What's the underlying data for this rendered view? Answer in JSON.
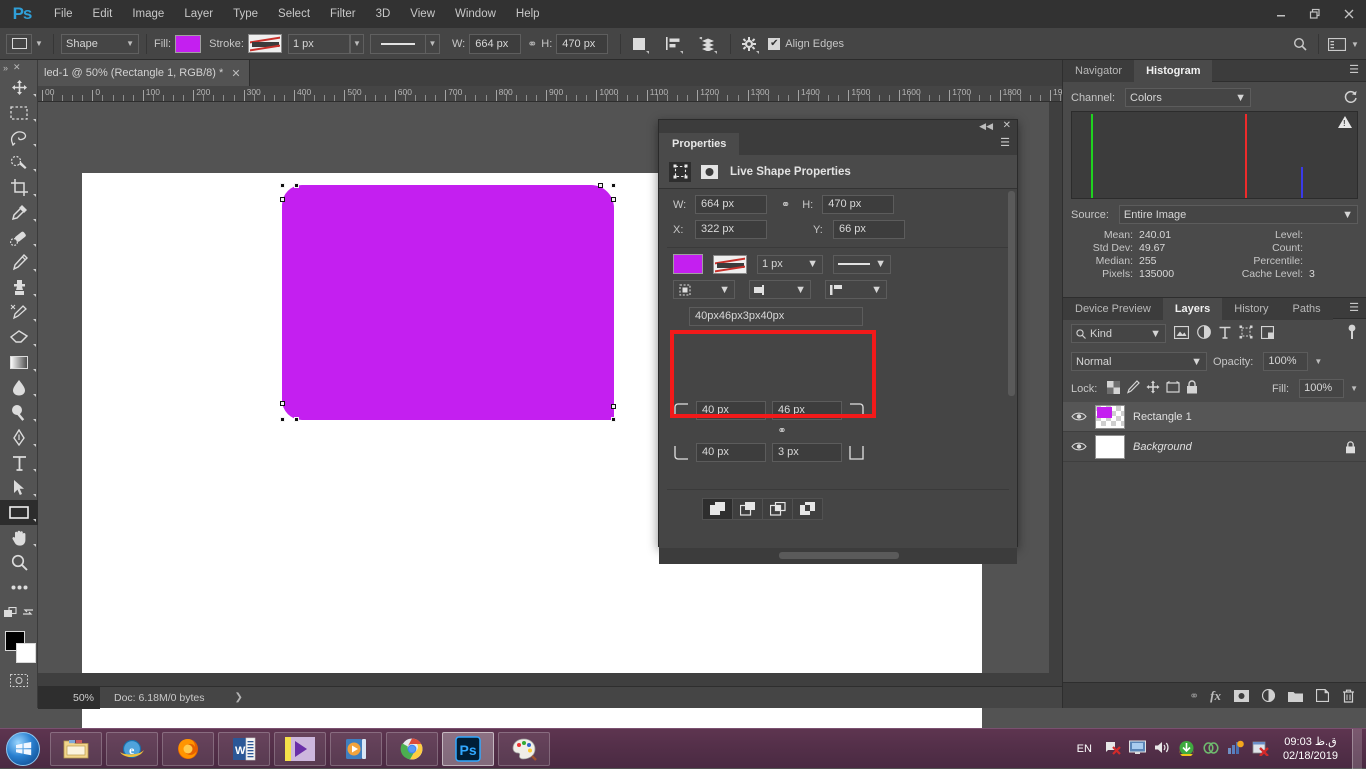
{
  "app": {
    "name": "Ps",
    "logo": "Ps"
  },
  "menubar": {
    "items": [
      "File",
      "Edit",
      "Image",
      "Layer",
      "Type",
      "Select",
      "Filter",
      "3D",
      "View",
      "Window",
      "Help"
    ],
    "window_buttons": [
      "minimize",
      "restore",
      "close"
    ]
  },
  "options_bar": {
    "tool_preset_icon": "rectangle-shape-icon",
    "mode": "Shape",
    "fill_label": "Fill:",
    "fill_color": "#c41ff0",
    "stroke_label": "Stroke:",
    "stroke_width": "1 px",
    "stroke_style": "solid-line",
    "w_label": "W:",
    "w_value": "664 px",
    "link_icon": "link-icon",
    "h_label": "H:",
    "h_value": "470 px",
    "path_op_icon": "path-operations-icon",
    "align_icon": "path-alignment-icon",
    "arrange_icon": "path-arrangement-icon",
    "gear_icon": "gear-icon",
    "align_edges_checked": true,
    "align_edges_label": "Align Edges",
    "search_icon": "search-icon",
    "workspace_icon": "workspace-icon"
  },
  "toolbar": {
    "tools": [
      {
        "name": "move-tool",
        "glyph": "move"
      },
      {
        "name": "rectangular-marquee-tool",
        "glyph": "marquee"
      },
      {
        "name": "lasso-tool",
        "glyph": "lasso"
      },
      {
        "name": "quick-selection-tool",
        "glyph": "quickselect"
      },
      {
        "name": "crop-tool",
        "glyph": "crop"
      },
      {
        "name": "eyedropper-tool",
        "glyph": "eyedropper"
      },
      {
        "name": "spot-healing-brush-tool",
        "glyph": "healing"
      },
      {
        "name": "brush-tool",
        "glyph": "brush"
      },
      {
        "name": "clone-stamp-tool",
        "glyph": "stamp"
      },
      {
        "name": "history-brush-tool",
        "glyph": "historybrush"
      },
      {
        "name": "eraser-tool",
        "glyph": "eraser"
      },
      {
        "name": "gradient-tool",
        "glyph": "gradient"
      },
      {
        "name": "blur-tool",
        "glyph": "blur"
      },
      {
        "name": "dodge-tool",
        "glyph": "dodge"
      },
      {
        "name": "pen-tool",
        "glyph": "pen"
      },
      {
        "name": "horizontal-type-tool",
        "glyph": "type"
      },
      {
        "name": "path-selection-tool",
        "glyph": "pathselect"
      },
      {
        "name": "rectangle-tool",
        "glyph": "rectangle",
        "active": true
      },
      {
        "name": "hand-tool",
        "glyph": "hand"
      },
      {
        "name": "zoom-tool",
        "glyph": "zoom"
      },
      {
        "name": "edit-toolbar-tool",
        "glyph": "ellipsis"
      }
    ],
    "quick_mask_icon": "quick-mask-icon",
    "screen_mode_icon": "screen-mode-icon",
    "foreground_color": "#000000",
    "background_color": "#ffffff"
  },
  "document": {
    "tab_title": "led-1 @ 50% (Rectangle 1, RGB/8) *",
    "zoom_level": "50%",
    "status_doc": "Doc: 6.18M/0 bytes",
    "ruler_labels": [
      "00",
      "0",
      "100",
      "200",
      "300",
      "400",
      "500",
      "600",
      "700",
      "800",
      "900",
      "1000",
      "1100",
      "1200",
      "1300",
      "1400",
      "1500",
      "1600",
      "1700",
      "1800",
      "19"
    ],
    "shape": {
      "name": "Rectangle 1",
      "fill": "#c41ff0",
      "width": "664 px",
      "height": "470 px"
    }
  },
  "properties_panel": {
    "tab_label": "Properties",
    "title": "Live Shape Properties",
    "shape_icon": "live-shape-icon",
    "mask_icon": "mask-icon",
    "menu_icon": "panel-menu-icon",
    "collapse_icon": "collapse-icon",
    "close_icon": "close-icon",
    "w_label": "W:",
    "w_value": "664 px",
    "link_icon": "link-icon",
    "h_label": "H:",
    "h_value": "470 px",
    "x_label": "X:",
    "x_value": "322 px",
    "y_label": "Y:",
    "y_value": "66 px",
    "fill_color": "#c41ff0",
    "stroke_preview": "stroke-preview-icon",
    "stroke_width": "1 px",
    "stroke_style": "solid-line",
    "stroke_align_icon": "stroke-align-icon",
    "stroke_cap_icon": "stroke-cap-icon",
    "stroke_corner_icon": "stroke-corner-icon",
    "radius_summary": "40px46px3px40px",
    "radius_top_left": "40 px",
    "radius_top_right": "46 px",
    "radius_bottom_left": "40 px",
    "radius_bottom_right": "3 px",
    "radius_link_icon": "link-icon",
    "path_ops": [
      "combine-shapes-icon",
      "subtract-front-shape-icon",
      "intersect-shape-areas-icon",
      "exclude-overlapping-shapes-icon"
    ],
    "highlight_color": "#f21a1a"
  },
  "right_dock": {
    "top_tabs": [
      {
        "label": "Navigator",
        "active": false
      },
      {
        "label": "Histogram",
        "active": true
      }
    ],
    "histogram": {
      "channel_label": "Channel:",
      "channel_value": "Colors",
      "refresh_icon": "refresh-icon",
      "warning_icon": "cached-data-warning-icon",
      "source_label": "Source:",
      "source_value": "Entire Image",
      "stats": [
        {
          "key": "Mean:",
          "value": "240.01",
          "key2": "Level:",
          "value2": ""
        },
        {
          "key": "Std Dev:",
          "value": "49.67",
          "key2": "Count:",
          "value2": ""
        },
        {
          "key": "Median:",
          "value": "255",
          "key2": "Percentile:",
          "value2": ""
        },
        {
          "key": "Pixels:",
          "value": "135000",
          "key2": "Cache Level:",
          "value2": "3"
        }
      ]
    },
    "layers_tabs": [
      {
        "label": "Device Preview",
        "active": false
      },
      {
        "label": "Layers",
        "active": true
      },
      {
        "label": "History",
        "active": false
      },
      {
        "label": "Paths",
        "active": false
      }
    ],
    "layers_panel": {
      "filter_icon": "search-icon",
      "filter_value": "Kind",
      "filter_type_icons": [
        "pixel-layer-filter-icon",
        "adjustment-layer-filter-icon",
        "type-layer-filter-icon",
        "shape-layer-filter-icon",
        "smart-object-filter-icon"
      ],
      "filter_toggle_icon": "filter-toggle-icon",
      "blend_mode": "Normal",
      "opacity_label": "Opacity:",
      "opacity_value": "100%",
      "lock_label": "Lock:",
      "lock_icons": [
        "lock-transparent-pixels-icon",
        "lock-image-pixels-icon",
        "lock-position-icon",
        "lock-artboard-nesting-icon",
        "lock-all-icon"
      ],
      "fill_label": "Fill:",
      "fill_value": "100%",
      "layers": [
        {
          "name": "Rectangle 1",
          "visible": true,
          "selected": true,
          "locked": false,
          "italic": false,
          "thumb": "shape-thumb"
        },
        {
          "name": "Background",
          "visible": true,
          "selected": false,
          "locked": true,
          "italic": true,
          "thumb": "white-thumb"
        }
      ],
      "footer_icons": [
        "link-layers-icon",
        "add-layer-style-icon",
        "add-layer-mask-icon",
        "new-adjustment-layer-icon",
        "new-group-icon",
        "new-layer-icon",
        "delete-layer-icon"
      ]
    }
  },
  "taskbar": {
    "start_icon": "windows-start-icon",
    "apps": [
      {
        "name": "file-explorer-icon",
        "active": false
      },
      {
        "name": "internet-explorer-icon",
        "active": false
      },
      {
        "name": "firefox-icon",
        "active": false
      },
      {
        "name": "word-icon",
        "active": false
      },
      {
        "name": "movie-maker-icon",
        "active": false
      },
      {
        "name": "media-player-icon",
        "active": false
      },
      {
        "name": "chrome-icon",
        "active": false
      },
      {
        "name": "photoshop-icon",
        "active": true
      },
      {
        "name": "paint-icon",
        "active": false
      }
    ],
    "language": "EN",
    "tray_icons": [
      "network-error-icon",
      "display-icon",
      "volume-icon",
      "download-manager-icon",
      "link-icon",
      "update-icon",
      "antivirus-error-icon"
    ],
    "time": "09:03 ق.ظ",
    "date": "02/18/2019"
  }
}
